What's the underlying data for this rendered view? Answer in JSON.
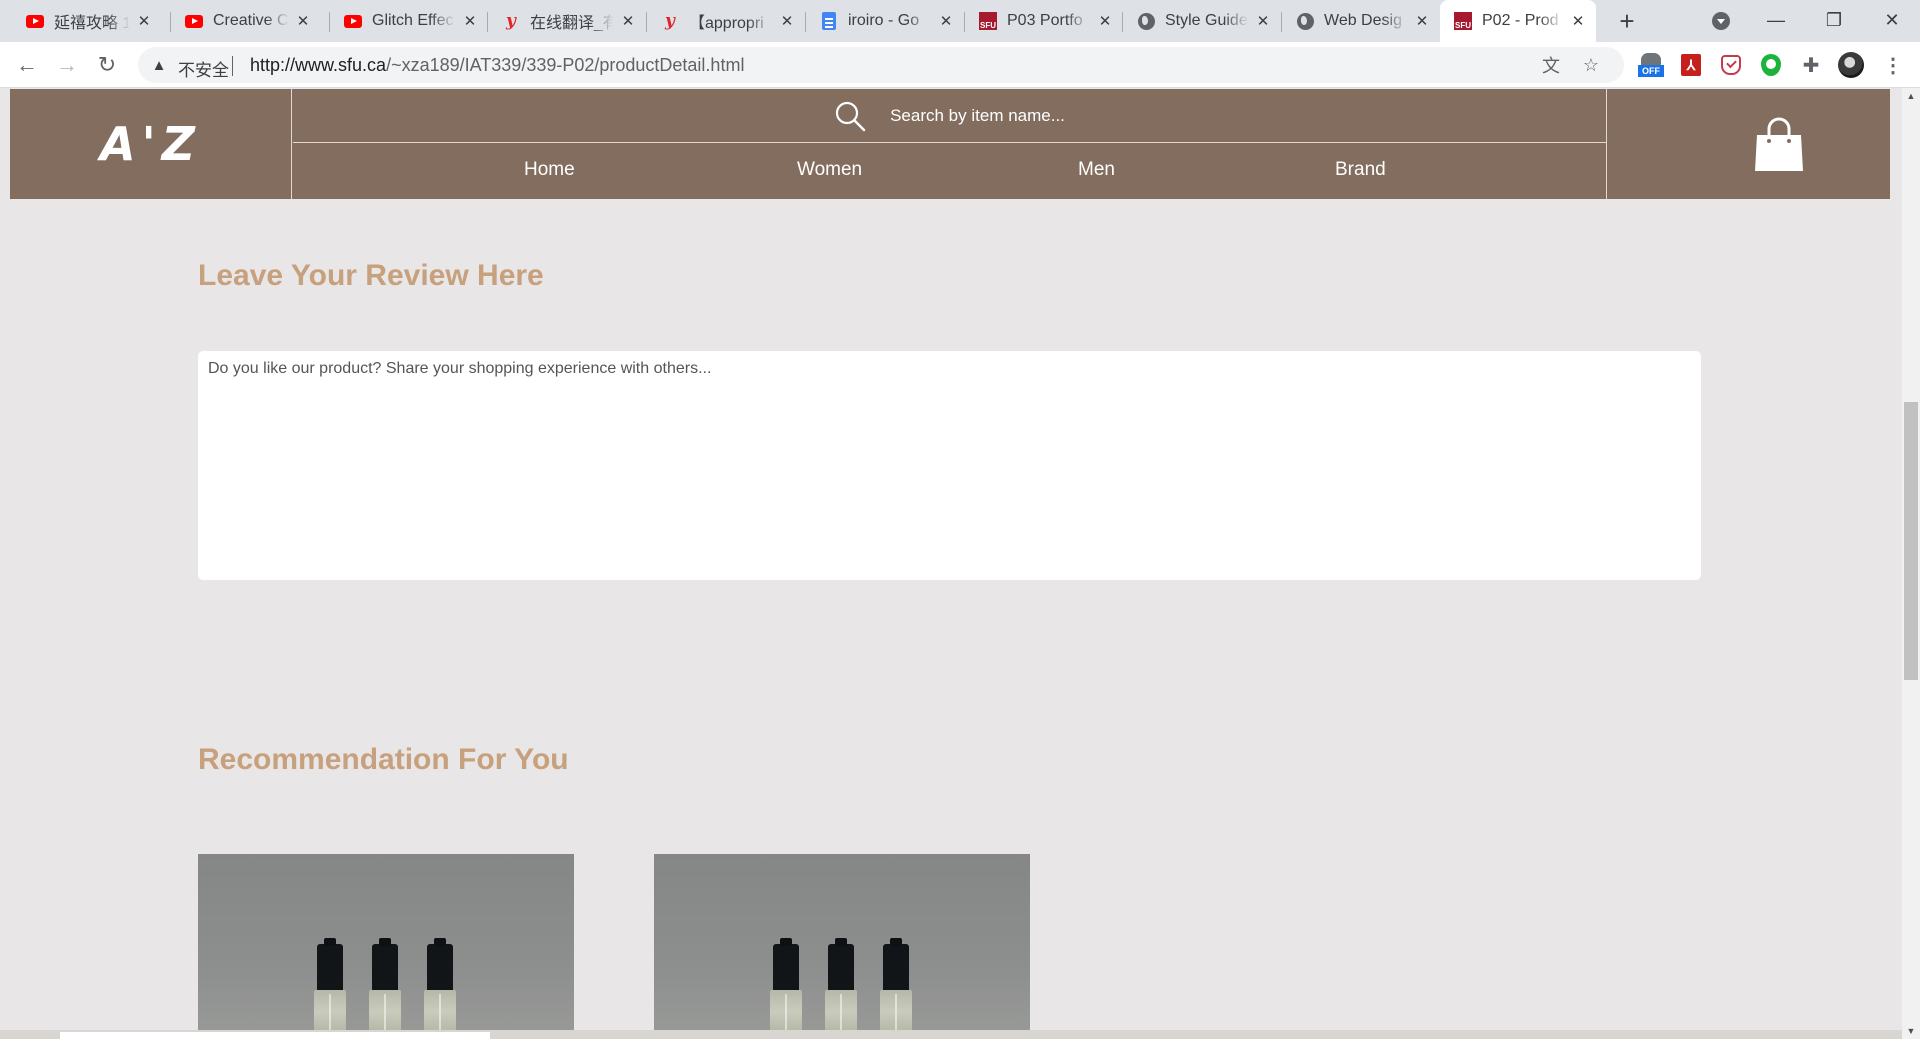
{
  "browser": {
    "tabs": [
      {
        "title": "延禧攻略 1(",
        "favicon": "youtube-icon"
      },
      {
        "title": "Creative CS",
        "favicon": "youtube-icon"
      },
      {
        "title": "Glitch Effec",
        "favicon": "youtube-icon"
      },
      {
        "title": "在线翻译_有",
        "favicon": "youdao-icon"
      },
      {
        "title": "【appropri",
        "favicon": "youdao-icon"
      },
      {
        "title": "iroiro - Go",
        "favicon": "google-docs-icon"
      },
      {
        "title": "P03 Portfo",
        "favicon": "sfu-icon"
      },
      {
        "title": "Style Guide",
        "favicon": "globe-icon"
      },
      {
        "title": "Web Desig",
        "favicon": "globe-icon"
      },
      {
        "title": "P02 - Prod",
        "favicon": "sfu-icon",
        "active": true
      }
    ],
    "new_tab_symbol": "+",
    "security_label": "不安全",
    "url_host": "http://www.sfu.ca",
    "url_path": "/~xza189/IAT339/339-P02/productDetail.html",
    "extension_off_badge": "OFF",
    "sfu_favicon_text": "SFU"
  },
  "site": {
    "logo": "A'Z",
    "search_placeholder": "Search by item name...",
    "menu": [
      "Home",
      "Women",
      "Men",
      "Brand"
    ]
  },
  "review": {
    "title": "Leave Your Review Here",
    "placeholder": "Do you like our product? Share your shopping experience with others..."
  },
  "recommendation": {
    "title": "Recommendation For You",
    "products": [
      {
        "image": "three perfume sample bottles on grey background"
      },
      {
        "image": "three perfume sample bottles on grey background"
      }
    ]
  },
  "colors": {
    "header_bg": "#836d5e",
    "accent_title": "#c7a07d",
    "page_bg": "#e8e6e6"
  }
}
